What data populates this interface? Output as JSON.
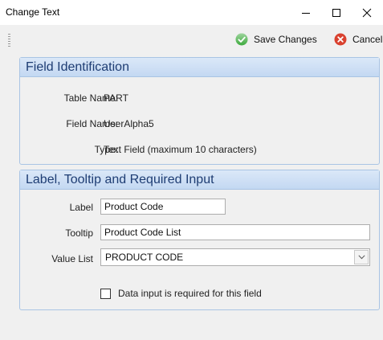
{
  "window": {
    "title": "Change Text",
    "minimize_icon": "minimize-icon",
    "maximize_icon": "maximize-icon",
    "close_icon": "close-icon"
  },
  "toolbar": {
    "save_label": "Save Changes",
    "save_icon": "check-circle-icon",
    "cancel_label": "Cancel",
    "cancel_icon": "x-circle-icon"
  },
  "field_identification": {
    "header": "Field Identification",
    "rows": [
      {
        "label": "Table Name:",
        "value": "PART"
      },
      {
        "label": "Field Name:",
        "value": "UserAlpha5"
      },
      {
        "label": "Type:",
        "value": "Text Field (maximum 10 characters)"
      }
    ]
  },
  "label_section": {
    "header": "Label, Tooltip and Required Input",
    "label_caption": "Label",
    "label_value": "Product Code",
    "tooltip_caption": "Tooltip",
    "tooltip_value": "Product Code List",
    "value_list_caption": "Value List",
    "value_list_selected": "PRODUCT CODE",
    "required_caption": "Data input is required for this field",
    "required_checked": false
  },
  "colors": {
    "group_border": "#a9c4e4",
    "group_header_text": "#1e3d73",
    "save_green": "#3daa3d",
    "cancel_red": "#d9412f"
  }
}
